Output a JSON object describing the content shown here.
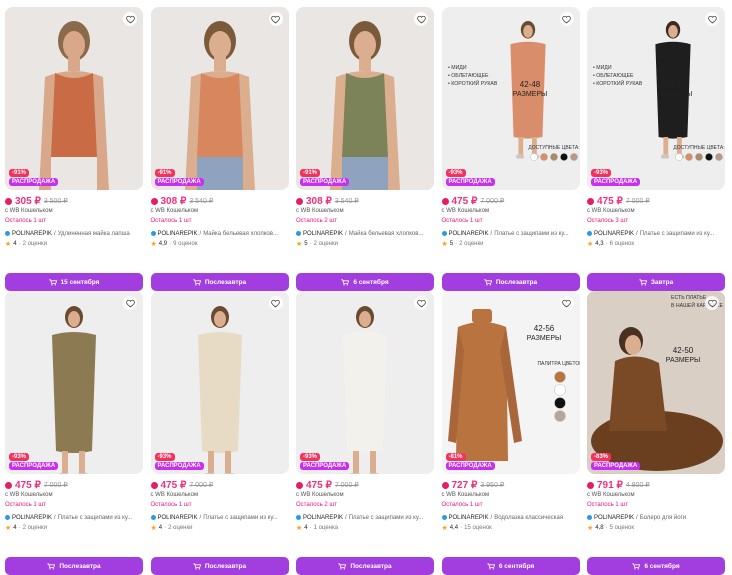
{
  "colors": {
    "accent": "#a23de0",
    "price": "#f0307a",
    "discount": "#f5315d",
    "sale": "#c82ff0"
  },
  "products": [
    {
      "discount": "-91%",
      "sale": "РАСПРОДАЖА",
      "price": "305 ₽",
      "old_price": "3 500 ₽",
      "wallet": "с WB Кошельком",
      "stock": "Осталось 1 шт",
      "brand": "POLINAREPIK",
      "name": "Удлиненная майка лапша",
      "rating": "4",
      "reviews": "2 оценки",
      "button": "15 сентября",
      "bg": "#e9e6e3",
      "cloth": "#c96b45",
      "skin": "#d9a88a",
      "hair": "#8a6a4a",
      "legs": "#e9e6e3",
      "type": "top"
    },
    {
      "discount": "-91%",
      "sale": "РАСПРОДАЖА",
      "price": "308 ₽",
      "old_price": "3 540 ₽",
      "wallet": "с WB Кошельком",
      "stock": "Осталось 1 шт",
      "brand": "POLINAREPIK",
      "name": "Майка бельевая хлопков...",
      "rating": "4,9",
      "reviews": "9 оценок",
      "button": "Послезавтра",
      "bg": "#e9e6e3",
      "cloth": "#d8865e",
      "skin": "#dcae90",
      "hair": "#7a5a3a",
      "legs": "#8fa3bf",
      "type": "top"
    },
    {
      "discount": "-91%",
      "sale": "РАСПРОДАЖА",
      "price": "308 ₽",
      "old_price": "3 540 ₽",
      "wallet": "с WB Кошельком",
      "stock": "Осталось 2 шт",
      "brand": "POLINAREPIK",
      "name": "Майка бельевая хлопков...",
      "rating": "5",
      "reviews": "2 оценки",
      "button": "6 сентября",
      "bg": "#e9e6e3",
      "cloth": "#7c8359",
      "skin": "#dcae90",
      "hair": "#7a5a3a",
      "legs": "#8fa3bf",
      "type": "top"
    },
    {
      "discount": "-93%",
      "sale": "РАСПРОДАЖА",
      "price": "475 ₽",
      "old_price": "7 000 ₽",
      "wallet": "с WB Кошельком",
      "stock": "Осталось 1 шт",
      "brand": "POLINAREPIK",
      "name": "Платье с защипами из ку...",
      "rating": "5",
      "reviews": "2 оценки",
      "button": "Послезавтра",
      "bg": "#eeeeee",
      "cloth": "#d98d6a",
      "skin": "#dcae90",
      "hair": "#6a4a30",
      "legs": "#eeeeee",
      "type": "dress",
      "overlay": [
        "• МИДИ",
        "• ОБЛЕГАЮЩЕЕ",
        "• КОРОТКИЙ РУКАВ"
      ],
      "size": "42-48 РАЗМЕРЫ",
      "palette_label": "ДОСТУПНЫЕ ЦВЕТА:"
    },
    {
      "discount": "-93%",
      "sale": "РАСПРОДАЖА",
      "price": "475 ₽",
      "old_price": "7 000 ₽",
      "wallet": "с WB Кошельком",
      "stock": "Осталось 3 шт",
      "brand": "POLINAREPIK",
      "name": "Платье с защипами из ку...",
      "rating": "4,3",
      "reviews": "6 оценок",
      "button": "Завтра",
      "bg": "#eeeeee",
      "cloth": "#1e1e1e",
      "skin": "#dcae90",
      "hair": "#3a2a20",
      "legs": "#eeeeee",
      "type": "dress",
      "overlay": [
        "• МИДИ",
        "• ОБЛЕГАЮЩЕЕ",
        "• КОРОТКИЙ РУКАВ"
      ],
      "size": "42-48 РАЗМЕРЫ",
      "palette_label": "ДОСТУПНЫЕ ЦВЕТА:"
    },
    {
      "discount": "-93%",
      "sale": "РАСПРОДАЖА",
      "price": "475 ₽",
      "old_price": "7 000 ₽",
      "wallet": "с WB Кошельком",
      "stock": "Осталось 1 шт",
      "brand": "POLINAREPIK",
      "name": "Платье с защипами из ку...",
      "rating": "4",
      "reviews": "2 оценки",
      "button": "Послезавтра",
      "bg": "#eeeeee",
      "cloth": "#8c7a52",
      "skin": "#dcae90",
      "hair": "#6a4a30",
      "legs": "#eeeeee",
      "type": "dress"
    },
    {
      "discount": "-93%",
      "sale": "РАСПРОДАЖА",
      "price": "475 ₽",
      "old_price": "7 000 ₽",
      "wallet": "с WB Кошельком",
      "stock": "Осталось 1 шт",
      "brand": "POLINAREPIK",
      "name": "Платье с защипами из ку...",
      "rating": "4",
      "reviews": "2 оценки",
      "button": "Послезавтра",
      "bg": "#eeeeee",
      "cloth": "#e7dbc6",
      "skin": "#dcae90",
      "hair": "#6a4a30",
      "legs": "#eeeeee",
      "type": "dress"
    },
    {
      "discount": "-93%",
      "sale": "РАСПРОДАЖА",
      "price": "475 ₽",
      "old_price": "7 000 ₽",
      "wallet": "с WB Кошельком",
      "stock": "Осталось 2 шт",
      "brand": "POLINAREPIK",
      "name": "Платье с защипами из ку...",
      "rating": "4",
      "reviews": "1 оценка",
      "button": "Послезавтра",
      "bg": "#eeeeee",
      "cloth": "#f3f1ec",
      "skin": "#dcae90",
      "hair": "#6a4a30",
      "legs": "#eeeeee",
      "type": "dress"
    },
    {
      "discount": "-81%",
      "sale": "РАСПРОДАЖА",
      "price": "727 ₽",
      "old_price": "3 950 ₽",
      "wallet": "с WB Кошельком",
      "stock": "Осталось 1 шт",
      "brand": "POLINAREPIK",
      "name": "Водолазка классическая",
      "rating": "4,4",
      "reviews": "15 оценок",
      "button": "6 сентября",
      "bg": "#f4f4f4",
      "cloth": "#b8733f",
      "skin": "#f4f4f4",
      "hair": "#f4f4f4",
      "legs": "#f4f4f4",
      "type": "turtleneck",
      "size": "42-56 РАЗМЕРЫ",
      "palette_label": "ПАЛИТРА ЦВЕТОВ"
    },
    {
      "discount": "-83%",
      "sale": "РАСПРОДАЖА",
      "price": "791 ₽",
      "old_price": "4 800 ₽",
      "wallet": "с WB Кошельком",
      "stock": "Осталось 1 шт",
      "brand": "POLINAREPIK",
      "name": "Болеро для йоги",
      "rating": "4,8",
      "reviews": "5 оценок",
      "button": "6 сентября",
      "bg": "#d9cfc4",
      "cloth": "#7a4a26",
      "skin": "#dcae90",
      "hair": "#4a3020",
      "legs": "#7a4a26",
      "type": "bolero",
      "overlay": [
        "ЕСТЬ ПЛАТЬЕ",
        "В НАШЕЙ КАРТОЧКЕ"
      ],
      "size": "42-50 РАЗМЕРЫ"
    }
  ]
}
